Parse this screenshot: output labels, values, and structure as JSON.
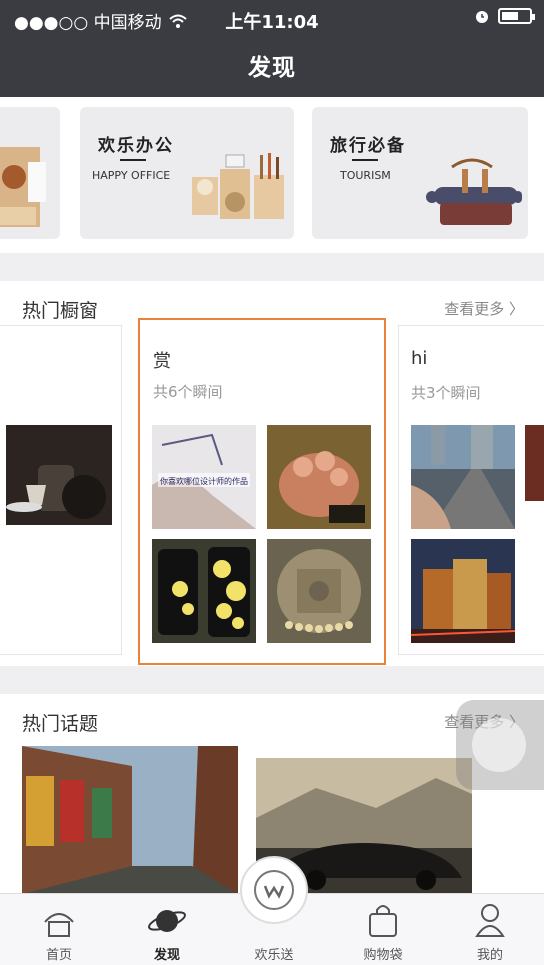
{
  "status_bar": {
    "carrier": "●●●○○ 中国移动",
    "time": "上午11:04"
  },
  "nav": {
    "title": "发现"
  },
  "categories": [
    {
      "title": "欢乐办公",
      "subtitle": "HAPPY OFFICE"
    },
    {
      "title": "旅行必备",
      "subtitle": "TOURISM"
    }
  ],
  "hot_windows": {
    "heading": "热门橱窗",
    "more": "查看更多 〉",
    "cards": [
      {
        "title": "赏",
        "count": "共6个瞬间"
      },
      {
        "title": "hi",
        "count": "共3个瞬间"
      }
    ],
    "thumb_caption": "你喜欢哪位设计师的作品"
  },
  "hot_topics": {
    "heading": "热门话题",
    "more": "查看更多 〉"
  },
  "tabbar": {
    "items": [
      {
        "label": "首页",
        "icon": "home-icon"
      },
      {
        "label": "发现",
        "icon": "planet-icon"
      },
      {
        "label": "欢乐送",
        "icon": "w-logo-icon"
      },
      {
        "label": "购物袋",
        "icon": "bag-icon"
      },
      {
        "label": "我的",
        "icon": "user-icon"
      }
    ],
    "active": "发现"
  },
  "colors": {
    "nav_bg": "#3a3c42",
    "highlight": "#e8833a"
  }
}
